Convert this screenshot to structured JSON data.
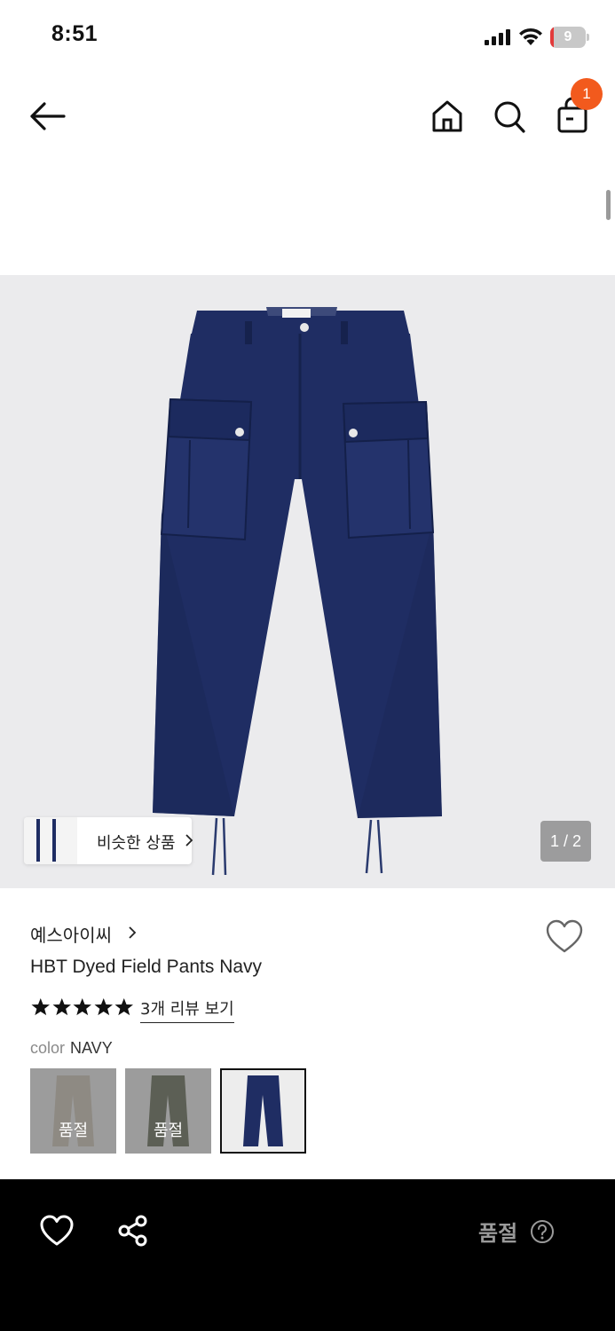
{
  "status_bar": {
    "time": "8:51",
    "battery_level": "9",
    "battery_percent": 9,
    "icons": [
      "cellular-signal-icon",
      "wifi-icon",
      "battery-icon"
    ]
  },
  "header": {
    "icons": [
      "back-arrow-icon",
      "home-icon",
      "search-icon",
      "shopping-bag-icon"
    ],
    "cart_count": "1",
    "badge_color": "#f25a1d"
  },
  "gallery": {
    "similar_label": "비슷한 상품",
    "page_counter": "1 / 2"
  },
  "product": {
    "brand": "예스아이씨",
    "title": "HBT Dyed Field Pants Navy",
    "rating": 5,
    "reviews_link": "3개 리뷰 보기",
    "color_label": "color",
    "color_value": "NAVY",
    "swatches": [
      {
        "name": "beige",
        "sold_out_label": "품절",
        "color": "#cfc6b6"
      },
      {
        "name": "olive",
        "sold_out_label": "품절",
        "color": "#5f6750"
      },
      {
        "name": "navy",
        "sold_out_label": "",
        "color": "#1f2d63"
      }
    ]
  },
  "bottom_bar": {
    "status": "품절",
    "icons": [
      "heart-icon",
      "share-icon",
      "help-circle-icon"
    ]
  },
  "colors": {
    "accent": "#f25a1d",
    "navy": "#1f2d63",
    "image_bg": "#ebebed"
  }
}
